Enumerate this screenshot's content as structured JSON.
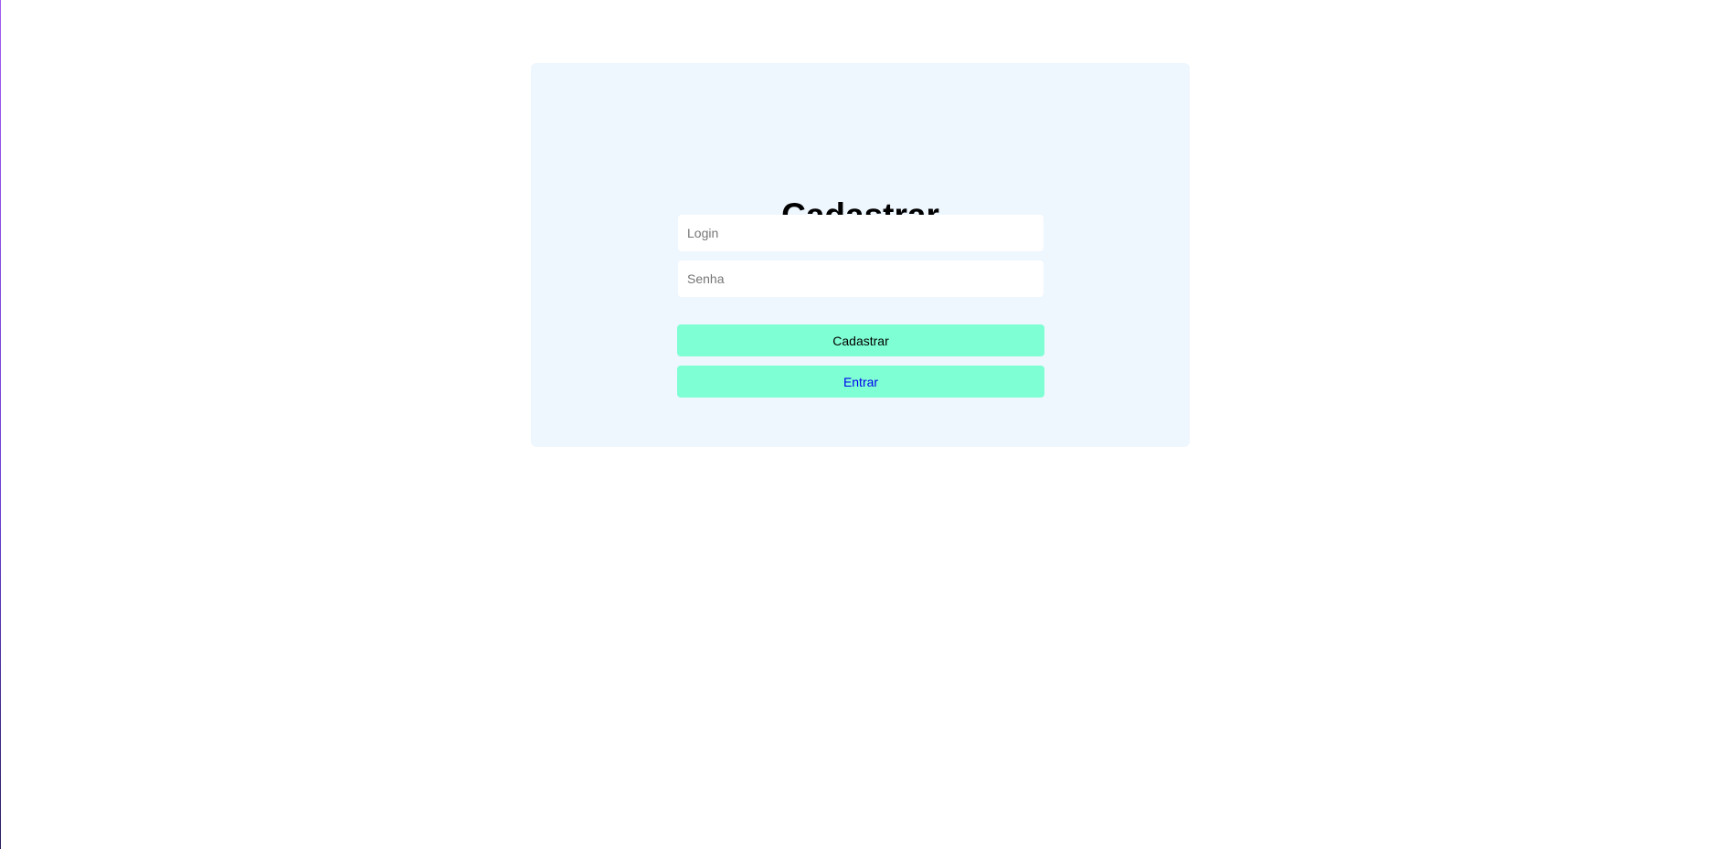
{
  "form": {
    "title": "Cadastrar",
    "login_placeholder": "Login",
    "senha_placeholder": "Senha",
    "submit_label": "Cadastrar",
    "link_label": "Entrar"
  },
  "colors": {
    "card_background": "#eef6fe",
    "button_background": "#7fffd4",
    "link_text": "#0000ee"
  }
}
